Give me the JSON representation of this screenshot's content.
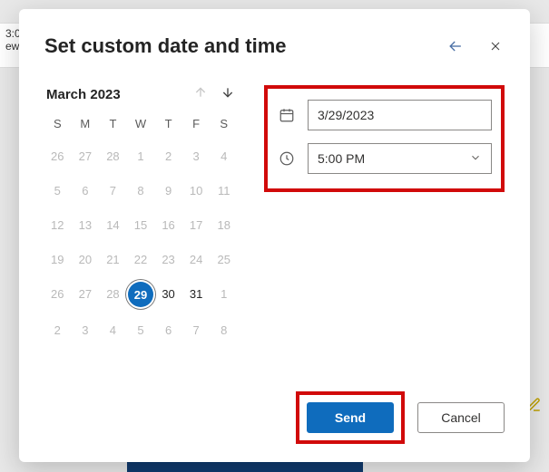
{
  "background": {
    "snippet_time": "3:0",
    "snippet_text": "ew"
  },
  "dialog": {
    "title": "Set custom date and time",
    "calendar": {
      "month_label": "March 2023",
      "dow": [
        "S",
        "M",
        "T",
        "W",
        "T",
        "F",
        "S"
      ],
      "cells": [
        {
          "n": "26",
          "cur": false
        },
        {
          "n": "27",
          "cur": false
        },
        {
          "n": "28",
          "cur": false
        },
        {
          "n": "1",
          "cur": false
        },
        {
          "n": "2",
          "cur": false
        },
        {
          "n": "3",
          "cur": false
        },
        {
          "n": "4",
          "cur": false
        },
        {
          "n": "5",
          "cur": false
        },
        {
          "n": "6",
          "cur": false
        },
        {
          "n": "7",
          "cur": false
        },
        {
          "n": "8",
          "cur": false
        },
        {
          "n": "9",
          "cur": false
        },
        {
          "n": "10",
          "cur": false
        },
        {
          "n": "11",
          "cur": false
        },
        {
          "n": "12",
          "cur": false
        },
        {
          "n": "13",
          "cur": false
        },
        {
          "n": "14",
          "cur": false
        },
        {
          "n": "15",
          "cur": false
        },
        {
          "n": "16",
          "cur": false
        },
        {
          "n": "17",
          "cur": false
        },
        {
          "n": "18",
          "cur": false
        },
        {
          "n": "19",
          "cur": false
        },
        {
          "n": "20",
          "cur": false
        },
        {
          "n": "21",
          "cur": false
        },
        {
          "n": "22",
          "cur": false
        },
        {
          "n": "23",
          "cur": false
        },
        {
          "n": "24",
          "cur": false
        },
        {
          "n": "25",
          "cur": false
        },
        {
          "n": "26",
          "cur": false
        },
        {
          "n": "27",
          "cur": false
        },
        {
          "n": "28",
          "cur": false
        },
        {
          "n": "29",
          "cur": true,
          "selected": true
        },
        {
          "n": "30",
          "cur": true
        },
        {
          "n": "31",
          "cur": true
        },
        {
          "n": "1",
          "cur": false
        },
        {
          "n": "2",
          "cur": false
        },
        {
          "n": "3",
          "cur": false
        },
        {
          "n": "4",
          "cur": false
        },
        {
          "n": "5",
          "cur": false
        },
        {
          "n": "6",
          "cur": false
        },
        {
          "n": "7",
          "cur": false
        },
        {
          "n": "8",
          "cur": false
        }
      ]
    },
    "inputs": {
      "date_value": "3/29/2023",
      "time_value": "5:00 PM"
    },
    "buttons": {
      "send": "Send",
      "cancel": "Cancel"
    }
  }
}
